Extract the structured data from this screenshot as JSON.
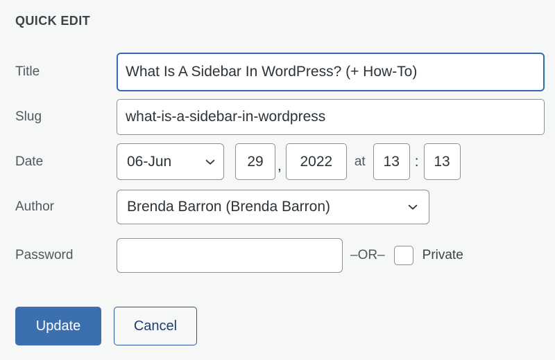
{
  "panel": {
    "heading": "QUICK EDIT"
  },
  "fields": {
    "title": {
      "label": "Title",
      "value": "What Is A Sidebar In WordPress? (+ How-To)",
      "placeholder": ""
    },
    "slug": {
      "label": "Slug",
      "value": "what-is-a-sidebar-in-wordpress",
      "placeholder": ""
    },
    "date": {
      "label": "Date",
      "month_selected": "06-Jun",
      "day": "29",
      "comma": ",",
      "year": "2022",
      "at": "at",
      "hour": "13",
      "colon": ":",
      "minute": "13"
    },
    "author": {
      "label": "Author",
      "selected": "Brenda Barron (Brenda Barron)"
    },
    "password": {
      "label": "Password",
      "value": "",
      "placeholder": "",
      "or_text": "–OR–",
      "private_label": "Private",
      "private_checked": false
    }
  },
  "buttons": {
    "update": "Update",
    "cancel": "Cancel"
  },
  "colors": {
    "page_background": "#f6f7f7",
    "focus_border": "#2e6bb0",
    "field_border": "#8c8f94",
    "primary_button_bg": "#3c6fb0",
    "primary_button_text": "#ffffff",
    "secondary_button_border": "#2c5595",
    "secondary_button_text": "#1d3f73",
    "label_text": "#50575e",
    "heading_text": "#3c434a"
  },
  "icons": {
    "month_chevron": "chevron-down-icon",
    "author_chevron": "chevron-down-icon"
  }
}
